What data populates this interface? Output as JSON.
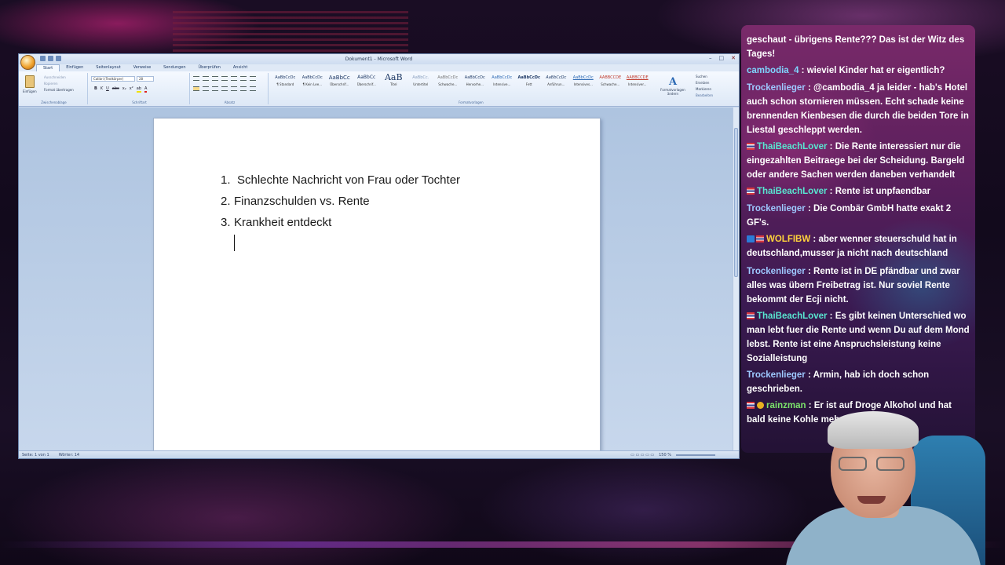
{
  "word": {
    "window_title": "Dokument1 - Microsoft Word",
    "tabs": [
      "Start",
      "Einfügen",
      "Seitenlayout",
      "Verweise",
      "Sendungen",
      "Überprüfen",
      "Ansicht"
    ],
    "clipboard": {
      "paste": "Einfügen",
      "cut": "Ausschneiden",
      "copy": "Kopieren",
      "format_painter": "Format übertragen",
      "group": "Zwischenablage"
    },
    "font": {
      "family": "Calibri (Textkörper)",
      "size": "28",
      "group": "Schriftart"
    },
    "paragraph_group": "Absatz",
    "styles": [
      {
        "sample": "AaBbCcDc",
        "name": "¶ Standard"
      },
      {
        "sample": "AaBbCcDc",
        "name": "¶ Kein Lee..."
      },
      {
        "sample": "AaBbCc",
        "name": "Überschrif..."
      },
      {
        "sample": "AaBbCc",
        "name": "Überschrif..."
      },
      {
        "sample": "AaB",
        "name": "Titel"
      },
      {
        "sample": "AaBbCc.",
        "name": "Untertitel"
      },
      {
        "sample": "AaBbCcDc",
        "name": "Schwache..."
      },
      {
        "sample": "AaBbCcDc",
        "name": "Hervorhe..."
      },
      {
        "sample": "AaBbCcDc",
        "name": "Intensive..."
      },
      {
        "sample": "AaBbCcDc",
        "name": "Fett"
      },
      {
        "sample": "AaBbCcDc",
        "name": "Anführun..."
      },
      {
        "sample": "AaBbCcDc",
        "name": "Intensives..."
      },
      {
        "sample": "AABBCCDE",
        "name": "Schwache..."
      },
      {
        "sample": "AABBCCDE",
        "name": "Intensiver..."
      }
    ],
    "styles_group": "Formatvorlagen",
    "change_styles": "Formatvorlagen ändern",
    "editing": {
      "find": "Suchen",
      "replace": "Ersetzen",
      "select": "Markieren",
      "group": "Bearbeiten"
    },
    "document": {
      "list": [
        {
          "num": "1.",
          "text": "Schlechte Nachricht von Frau oder Tochter"
        },
        {
          "num": "2.",
          "text": "Finanzschulden vs. Rente"
        },
        {
          "num": "3.",
          "text": "Krankheit entdeckt"
        }
      ]
    },
    "status": {
      "page": "Seite: 1 von 1",
      "words": "Wörter: 14",
      "zoom": "150 %"
    }
  },
  "chat": {
    "messages": [
      {
        "user": "",
        "text": "geschaut - übrigens Rente??? Das ist der Witz des Tages!",
        "badges": [],
        "color": "#ffffff"
      },
      {
        "user": "cambodia_4",
        "text": "wieviel Kinder hat er eigentlich?",
        "badges": [],
        "color": "#7fd6ff"
      },
      {
        "user": "Trockenlieger",
        "text": "@cambodia_4 ja leider - hab's Hotel auch schon stornieren müssen. Echt schade keine brennenden Kienbesen die durch die beiden Tore in Liestal geschleppt werden.",
        "badges": [],
        "color": "#9ec9ff"
      },
      {
        "user": "ThaiBeachLover",
        "text": "Die Rente interessiert nur die eingezahlten Beitraege bei der Scheidung. Bargeld oder andere Sachen werden daneben verhandelt",
        "badges": [
          "thai-flag"
        ],
        "color": "#58e6d0"
      },
      {
        "user": "ThaiBeachLover",
        "text": "Rente ist unpfaendbar",
        "badges": [
          "thai-flag"
        ],
        "color": "#58e6d0"
      },
      {
        "user": "Trockenlieger",
        "text": "Die Combär GmbH hatte exakt 2 GF's.",
        "badges": [],
        "color": "#9ec9ff"
      },
      {
        "user": "WOLFIBW",
        "text": "aber wenner steuerschuld hat in deutschland,musser ja nicht nach deutschland",
        "badges": [
          "prime",
          "thai-flag"
        ],
        "color": "#ffd23c"
      },
      {
        "user": "Trockenlieger",
        "text": "Rente ist in DE pfändbar und zwar alles was übern Freibetrag ist. Nur soviel Rente bekommt der Ecji nicht.",
        "badges": [],
        "color": "#9ec9ff"
      },
      {
        "user": "ThaiBeachLover",
        "text": "Es gibt keinen Unterschied wo man lebt fuer die Rente und wenn Du auf dem Mond lebst. Rente ist eine Anspruchsleistung keine Sozialleistung",
        "badges": [
          "thai-flag"
        ],
        "color": "#58e6d0"
      },
      {
        "user": "Trockenlieger",
        "text": "Armin, hab ich doch schon geschrieben.",
        "badges": [],
        "color": "#9ec9ff"
      },
      {
        "user": "rainzman",
        "text": "Er ist auf Droge Alkohol und hat bald keine Kohle mehr",
        "badges": [
          "thai-flag",
          "gold"
        ],
        "color": "#7be36b"
      }
    ]
  }
}
